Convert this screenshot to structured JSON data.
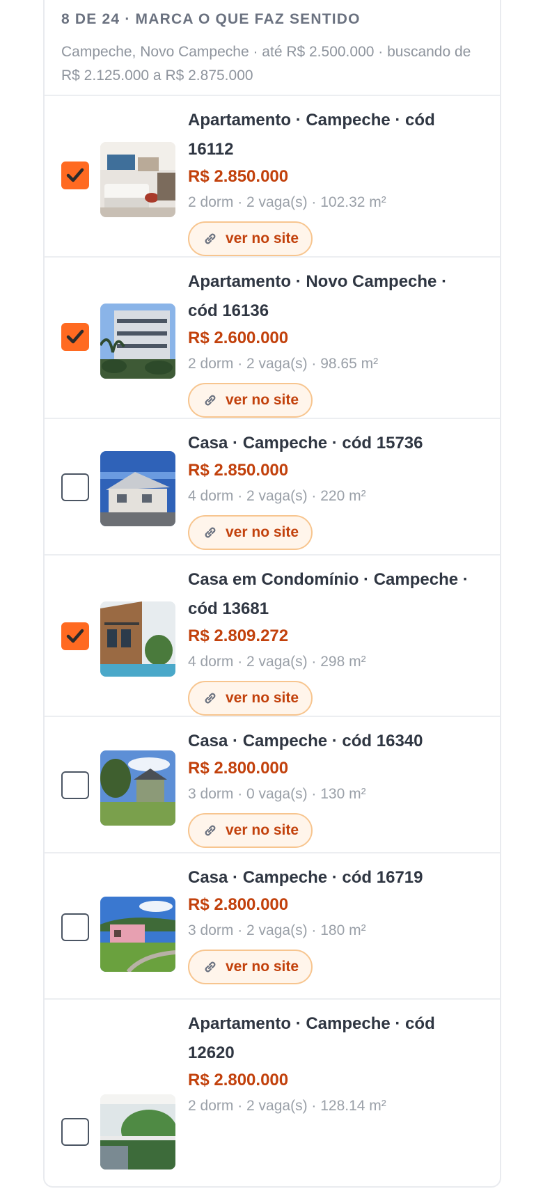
{
  "header": {
    "title": "8 DE 24 · MARCA O QUE FAZ SENTIDO",
    "subtitle": "Campeche, Novo Campeche · até R$ 2.500.000 · buscando de R$ 2.125.000 a R$ 2.875.000"
  },
  "button_label": "ver no site",
  "accent_color": "#ff6a21",
  "listings": [
    {
      "title": "Apartamento · Campeche · cód 16112",
      "price": "R$ 2.850.000",
      "specs": "2 dorm · 2 vaga(s) · 102.32 m²",
      "checked": true
    },
    {
      "title": "Apartamento · Novo Campeche · cód 16136",
      "price": "R$ 2.600.000",
      "specs": "2 dorm · 2 vaga(s) · 98.65 m²",
      "checked": true
    },
    {
      "title": "Casa · Campeche · cód 15736",
      "price": "R$ 2.850.000",
      "specs": "4 dorm · 2 vaga(s) · 220 m²",
      "checked": false
    },
    {
      "title": "Casa em Condomínio · Campeche · cód 13681",
      "price": "R$ 2.809.272",
      "specs": "4 dorm · 2 vaga(s) · 298 m²",
      "checked": true
    },
    {
      "title": "Casa · Campeche · cód 16340",
      "price": "R$ 2.800.000",
      "specs": "3 dorm · 0 vaga(s) · 130 m²",
      "checked": false
    },
    {
      "title": "Casa · Campeche · cód 16719",
      "price": "R$ 2.800.000",
      "specs": "3 dorm · 2 vaga(s) · 180 m²",
      "checked": false
    },
    {
      "title": "Apartamento · Campeche · cód 12620",
      "price": "R$ 2.800.000",
      "specs": "2 dorm · 2 vaga(s) · 128.14 m²",
      "checked": false
    }
  ]
}
